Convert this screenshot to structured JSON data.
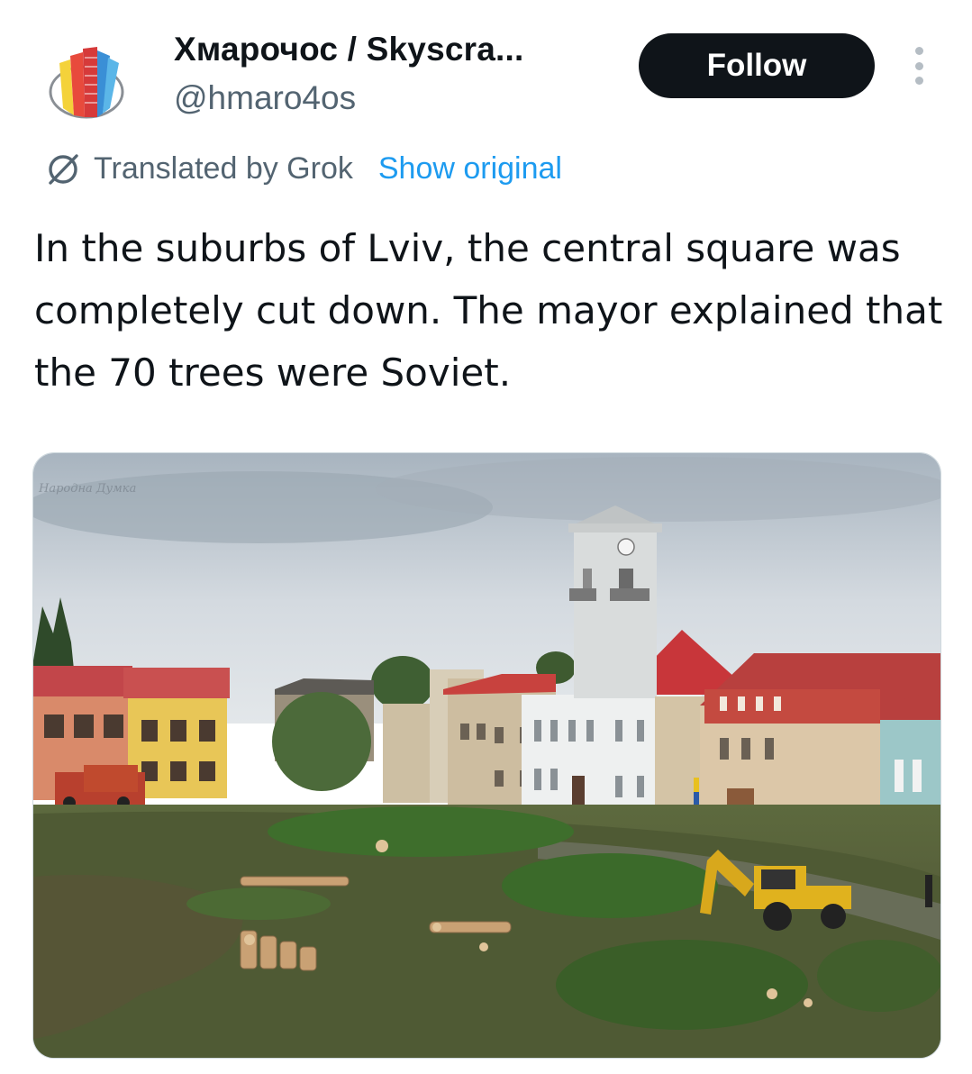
{
  "account": {
    "display_name": "Хмарочос / Skyscra...",
    "handle": "@hmaro4os",
    "avatar_icon": "skyscraper-logo-icon"
  },
  "actions": {
    "follow_label": "Follow",
    "more_icon": "more-vertical-icon"
  },
  "translation": {
    "label": "Translated by Grok",
    "show_original_label": "Show original",
    "icon": "grok-icon"
  },
  "tweet": {
    "text": "In the suburbs of Lviv, the central square was completely cut down. The mayor explained that the 70 trees were Soviet."
  },
  "media": {
    "watermark": "Народна Думка"
  },
  "colors": {
    "follow_bg": "#0f1419",
    "link": "#1d9bf0",
    "secondary_text": "#536471"
  }
}
